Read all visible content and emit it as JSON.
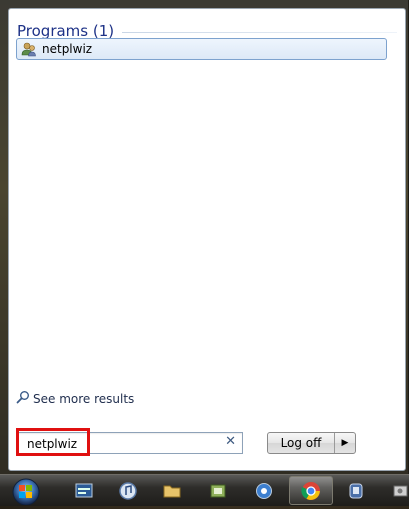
{
  "start_menu": {
    "group_title": "Programs (1)",
    "results": [
      {
        "label": "netplwiz",
        "icon": "users-icon"
      }
    ],
    "see_more_label": "See more results",
    "search": {
      "value": "netplwiz",
      "clear_icon": "close-icon"
    },
    "logoff_label": "Log off"
  },
  "taskbar": {
    "items": [
      {
        "name": "start-orb",
        "icon": "windows-orb-icon"
      },
      {
        "name": "taskbar-item-1",
        "icon": "window-icon"
      },
      {
        "name": "taskbar-item-2",
        "icon": "itunes-icon"
      },
      {
        "name": "taskbar-item-3",
        "icon": "folder-icon"
      },
      {
        "name": "taskbar-item-4",
        "icon": "app-icon"
      },
      {
        "name": "taskbar-item-5",
        "icon": "blue-circle-icon"
      },
      {
        "name": "taskbar-item-chrome",
        "icon": "chrome-icon",
        "active": true
      },
      {
        "name": "taskbar-item-7",
        "icon": "app-icon"
      },
      {
        "name": "taskbar-item-8",
        "icon": "app-icon"
      }
    ]
  },
  "colors": {
    "highlight": "#e01010",
    "group_title": "#1e3287",
    "selected_result_border": "#7da2ce"
  }
}
